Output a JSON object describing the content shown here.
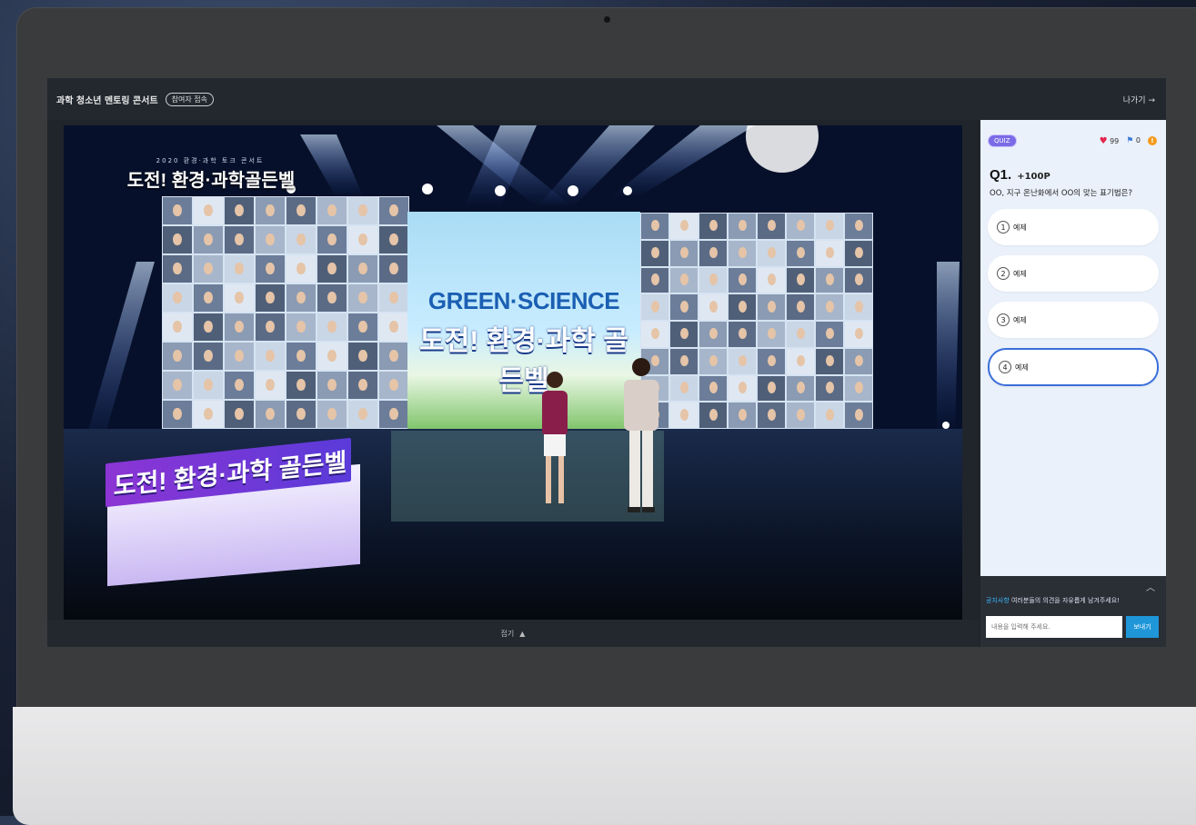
{
  "header": {
    "event_title": "과학 청소년 멘토링 콘서트",
    "status": "참여자 접속",
    "exit_label": "나가기 →"
  },
  "video": {
    "caption_small": "2020 환경·과학 토크 콘서트",
    "caption_title": "도전! 환경·과학골든벨",
    "screen_logo": "GREEN·SCIENCE",
    "screen_title": "도전! 환경·과학 골든벨",
    "podium_banner": "도전! 환경·과학 골든벨",
    "footer_label": "접기",
    "footer_icon": "chevron-up-icon"
  },
  "quiz": {
    "badge": "QUIZ",
    "hearts": "99",
    "flags": "0",
    "coin": "!",
    "question_number": "Q1.",
    "question_points": "+100P",
    "question_text": "OO, 지구 온난화에서 OO의 맞는 표기법은?",
    "options": [
      {
        "num": "1",
        "label": "예제",
        "selected": false
      },
      {
        "num": "2",
        "label": "예제",
        "selected": false
      },
      {
        "num": "3",
        "label": "예제",
        "selected": false
      },
      {
        "num": "4",
        "label": "예제",
        "selected": true
      }
    ]
  },
  "chat": {
    "notice_prefix": "공지사항",
    "notice_text": "여러분들의 의견을 자유롭게 남겨주세요!",
    "input_placeholder": "내용을 입력해 주세요.",
    "send_label": "보내기",
    "collapse_icon": "chevron-up-icon"
  },
  "colors": {
    "accent": "#3a6fd9",
    "send": "#1e96d8",
    "heart": "#e2264d",
    "coin": "#f59a1b"
  }
}
